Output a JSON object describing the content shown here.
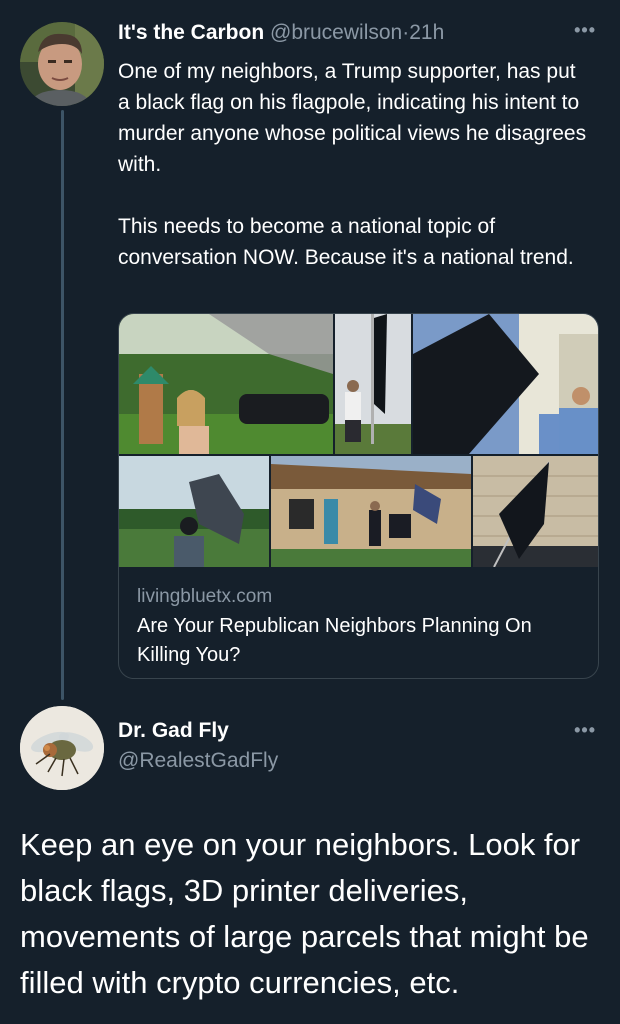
{
  "tweet1": {
    "display_name": "It's the Carbon",
    "handle": "@brucewilson",
    "time": "21h",
    "more_label": "•••",
    "paragraphs": [
      "One of my neighbors, a Trump supporter, has put a black flag on his flagpole, indicating his intent to murder anyone whose political views he disagrees with.",
      "This needs to become a national topic of conversation NOW. Because it's a national trend."
    ],
    "card": {
      "domain": "livingbluetx.com",
      "title": "Are Your Republican Neighbors Planning On Killing You?"
    }
  },
  "tweet2": {
    "display_name": "Dr. Gad Fly",
    "handle": "@RealestGadFly",
    "more_label": "•••",
    "text": "Keep an eye on your neighbors. Look for black flags, 3D printer deliveries, movements of large parcels that might be filled with crypto currencies, etc."
  },
  "colors": {
    "background": "#15202b",
    "secondary_text": "#8b98a5",
    "border": "#38444d"
  }
}
